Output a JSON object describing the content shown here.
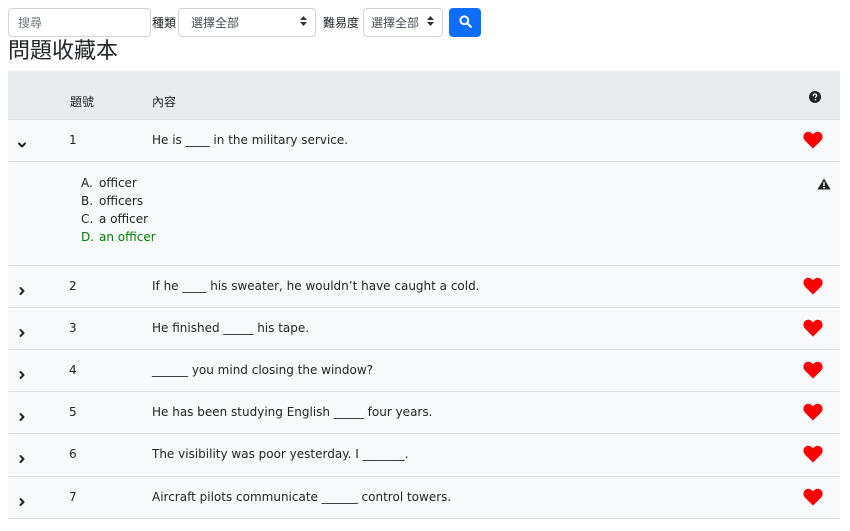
{
  "search": {
    "placeholder": "搜尋"
  },
  "filters": {
    "type_label": "種類",
    "type_value": "選擇全部",
    "level_label": "難易度",
    "level_value": "選擇全部"
  },
  "page_title": "問題收藏本",
  "table": {
    "headers": {
      "number": "題號",
      "content": "內容"
    },
    "rows": [
      {
        "number": "1",
        "content": "He is ____ in the military service."
      },
      {
        "number": "2",
        "content": "If he ____ his sweater, he wouldn’t have caught a cold."
      },
      {
        "number": "3",
        "content": "He finished _____ his tape."
      },
      {
        "number": "4",
        "content": "______ you mind closing the window?"
      },
      {
        "number": "5",
        "content": "He has been studying English _____ four years."
      },
      {
        "number": "6",
        "content": "The visibility was poor yesterday. I _______."
      },
      {
        "number": "7",
        "content": "Aircraft pilots communicate ______ control towers."
      }
    ],
    "expanded_options": [
      {
        "letter": "A.",
        "text": "officer"
      },
      {
        "letter": "B.",
        "text": "officers"
      },
      {
        "letter": "C.",
        "text": "a officer"
      },
      {
        "letter": "D.",
        "text": "an officer"
      }
    ]
  },
  "colors": {
    "accent": "#0d6efd",
    "heart": "#ff0000",
    "correct": "#008000",
    "header_bg": "#e9ecef"
  },
  "icons": {
    "search_button": "search-icon",
    "help": "question-circle-icon",
    "favorite": "heart-icon",
    "report": "warning-triangle-icon",
    "expand": "chevron-right-icon",
    "collapse": "chevron-down-icon"
  }
}
